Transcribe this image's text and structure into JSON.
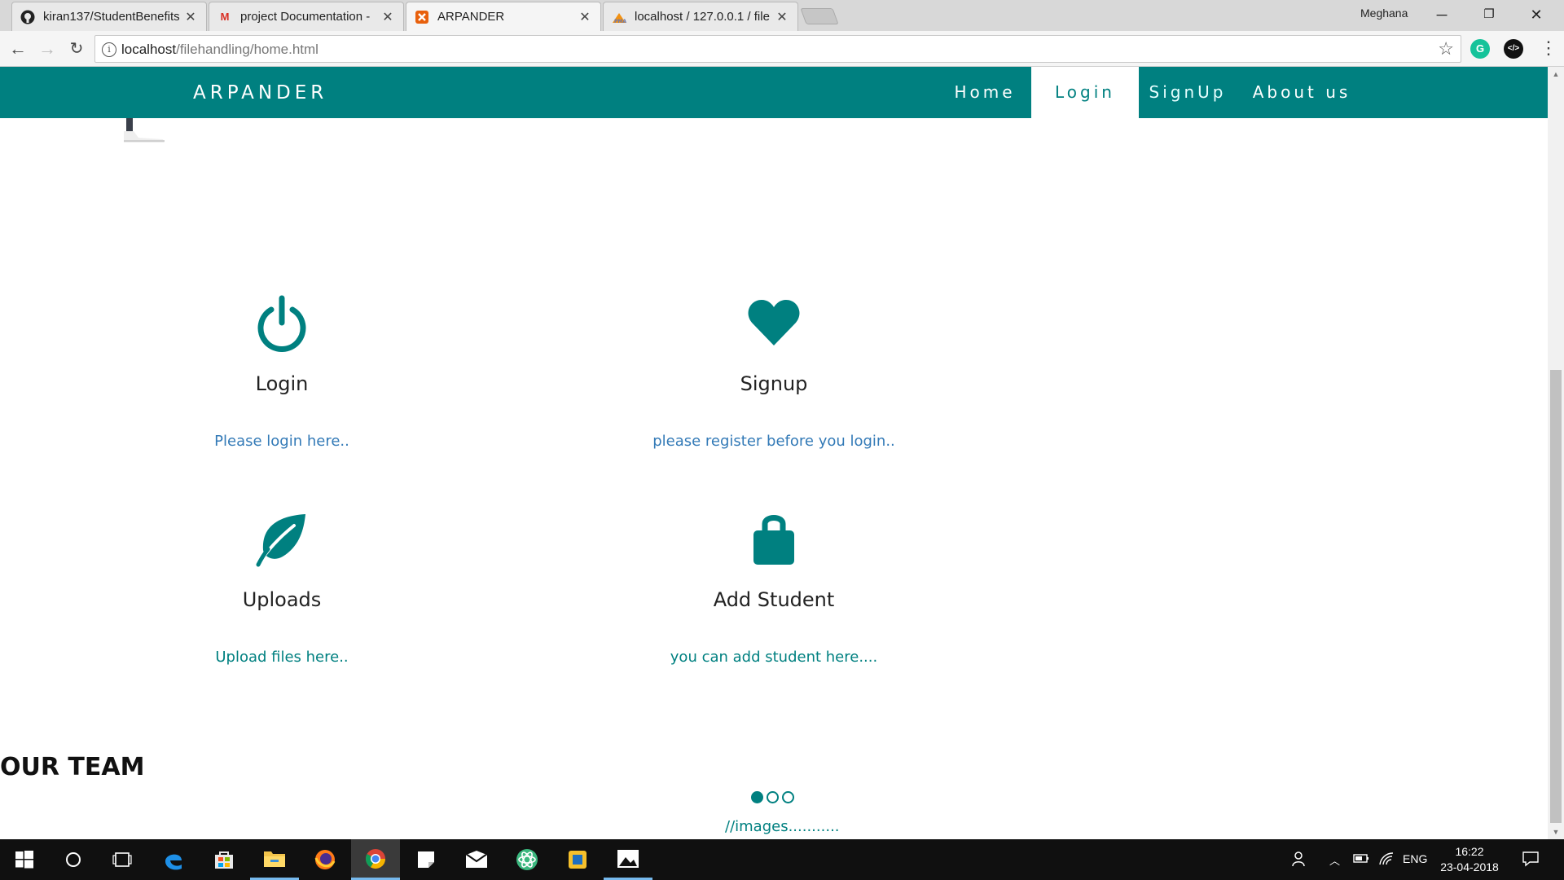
{
  "browser": {
    "tabs": [
      {
        "title": "kiran137/StudentBenefits",
        "favicon": "github-icon"
      },
      {
        "title": "project Documentation -",
        "favicon": "gmail-icon"
      },
      {
        "title": "ARPANDER",
        "favicon": "xampp-icon",
        "active": true
      },
      {
        "title": "localhost / 127.0.0.1 / file",
        "favicon": "phpmyadmin-icon"
      }
    ],
    "profile_name": "Meghana",
    "url_host": "localhost",
    "url_path": "/filehandling/home.html"
  },
  "site": {
    "brand": "ARPANDER",
    "nav": [
      {
        "label": "Home"
      },
      {
        "label": "Login"
      },
      {
        "label": "SignUp"
      },
      {
        "label": "About us"
      }
    ],
    "features": [
      {
        "title": "Login",
        "desc": "Please login here..",
        "icon": "power-icon",
        "desc_color": "#337ab7"
      },
      {
        "title": "Signup",
        "desc": "please register before you login..",
        "icon": "heart-icon",
        "desc_color": "#337ab7"
      },
      {
        "title": "Uploads",
        "desc": "Upload files here..",
        "icon": "leaf-icon",
        "desc_color": "#008080"
      },
      {
        "title": "Add Student",
        "desc": "you can add student here....",
        "icon": "lock-icon",
        "desc_color": "#008080"
      }
    ],
    "team_heading": "OUR TEAM",
    "carousel_placeholder": "//images...........",
    "accent_color": "#008080"
  },
  "taskbar": {
    "language": "ENG",
    "time": "16:22",
    "date": "23-04-2018"
  }
}
